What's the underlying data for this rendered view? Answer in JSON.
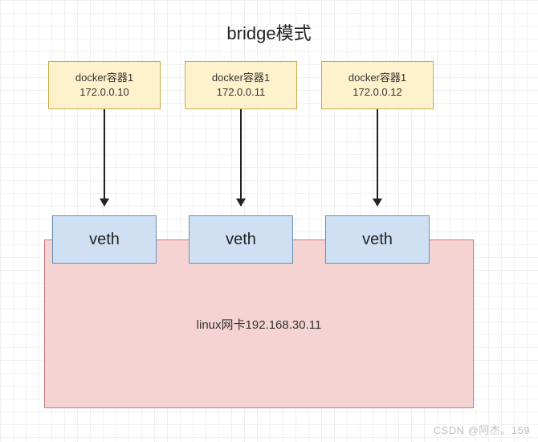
{
  "title": "bridge模式",
  "containers": [
    {
      "name": "docker容器1",
      "ip": "172.0.0.10"
    },
    {
      "name": "docker容器1",
      "ip": "172.0.0.11"
    },
    {
      "name": "docker容器1",
      "ip": "172.0.0.12"
    }
  ],
  "veths": [
    {
      "label": "veth"
    },
    {
      "label": "veth"
    },
    {
      "label": "veth"
    }
  ],
  "linux": {
    "label": "linux网卡192.168.30.11"
  },
  "watermark": "CSDN @阿杰。159"
}
